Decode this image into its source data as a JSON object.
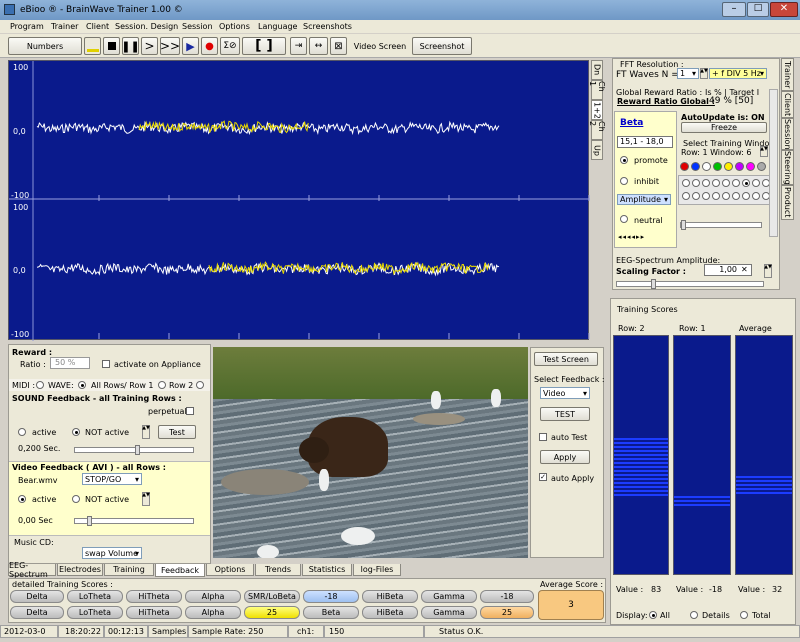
{
  "window": {
    "title": "eBioo ® - BrainWave Trainer 1.00 ©"
  },
  "menu": [
    "Program",
    "Trainer",
    "Client",
    "Session. Design",
    "Session",
    "Options",
    "Language",
    "Screenshots"
  ],
  "toolbar": {
    "numbers": "Numbers",
    "video_screen": "Video Screen",
    "screenshot": "Screenshot",
    "brackets": "[ ]"
  },
  "eeg": {
    "y_top_1": "100",
    "y_zero_1": "0,0",
    "y_bottom_1": "-100",
    "y_top_2": "100",
    "y_zero_2": "0,0",
    "y_bottom_2": "-100",
    "bg": "#0a1a8c"
  },
  "side_tabs": [
    "Dn",
    "Ch 1",
    "1+2",
    "Ch 2",
    "Up"
  ],
  "fft": {
    "resolution_label": "FFT Resolution :",
    "waves_label": "FT Waves N =",
    "waves_value": "1",
    "div_value": "+ f DIV  5 Hz"
  },
  "reward_ratio": {
    "label": "Global Reward Ratio :",
    "is_target": "Is % | Target I",
    "global_label": "Reward Ratio Global :",
    "global_value": "49 % [50]"
  },
  "band": {
    "name": "Beta",
    "range": "15,1 - 18,0",
    "promote": "promote",
    "inhibit": "inhibit",
    "amplitude": "Amplitude",
    "neutral": "neutral"
  },
  "autoupdate": {
    "label": "AutoUpdate is: ON",
    "freeze": "Freeze",
    "select_window": "Select Training Window",
    "row_label": "Row:  1  Window:  6"
  },
  "dot_colors": [
    "#e00000",
    "#0033ff",
    "#ffffff",
    "#00c000",
    "#ffee00",
    "#c000ff",
    "#ff00ff",
    "#aaaaaa"
  ],
  "right_tabs": [
    "Trainer",
    "Client",
    "Session",
    "Steering",
    "Product"
  ],
  "spectrum": {
    "label": "EEG-Spectrum Amplitude:",
    "scaling_label": "Scaling Factor :",
    "scaling_value": "1,00"
  },
  "training_scores": {
    "title": "Training Scores",
    "col1": "Row: 2",
    "col2": "Row: 1",
    "col3": "Average",
    "val1_label": "Value :",
    "val1": "83",
    "val2_label": "Value :",
    "val2": "-18",
    "val3_label": "Value :",
    "val3": "32",
    "display_label": "Display:",
    "display_all": "All",
    "display_details": "Details",
    "display_total": "Total"
  },
  "reward": {
    "label": "Reward :",
    "ratio_label": "Ratio :",
    "ratio_value": "50 %",
    "activate": "activate on Appliance"
  },
  "midi": {
    "midi": "MIDI :",
    "wave": "WAVE:",
    "all_rows": "All Rows",
    "row1": "/ Row 1",
    "row2": "Row 2"
  },
  "sound": {
    "title": "SOUND Feedback - all Training Rows :",
    "perpetual": "perpetual :",
    "active": "active",
    "not_active": "NOT active",
    "test": "Test",
    "sec": "0,200 Sec."
  },
  "video": {
    "title": "Video Feedback ( AVI ) - all Rows :",
    "file": "Bear.wmv",
    "mode": "STOP/GO",
    "active": "active",
    "not_active": "NOT active",
    "sec": "0,00 Sec"
  },
  "music": {
    "label": "Music CD:",
    "swap": "swap Volume"
  },
  "feedback_ctrl": {
    "test_screen": "Test Screen",
    "select_feedback": "Select Feedback :",
    "video": "Video",
    "test": "TEST",
    "auto_test": "auto Test",
    "apply": "Apply",
    "auto_apply": "auto Apply"
  },
  "bottom_tabs_left": [
    "EEG-Spectrum",
    "Electrodes",
    "Training",
    "Feedback"
  ],
  "bottom_tabs_mid": [
    "Options",
    "Trends",
    "Statistics",
    "log-Files"
  ],
  "detailed": {
    "title": "detailed Training Scores :",
    "average_label": "Average Score :",
    "average_value": "3",
    "row1": [
      "Delta",
      "LoTheta",
      "HiTheta",
      "Alpha",
      "SMR/LoBeta",
      "-18",
      "HiBeta",
      "Gamma",
      "-18"
    ],
    "row2": [
      "Delta",
      "LoTheta",
      "HiTheta",
      "Alpha",
      "25",
      "Beta",
      "HiBeta",
      "Gamma",
      "25"
    ]
  },
  "status": {
    "date": "2012-03-0",
    "time": "18:20:22",
    "elapsed": "00:12:13",
    "samples": "Samples",
    "rate": "Sample Rate: 250",
    "ch": "ch1:",
    "ch_val": "150",
    "status": "Status O.K."
  }
}
